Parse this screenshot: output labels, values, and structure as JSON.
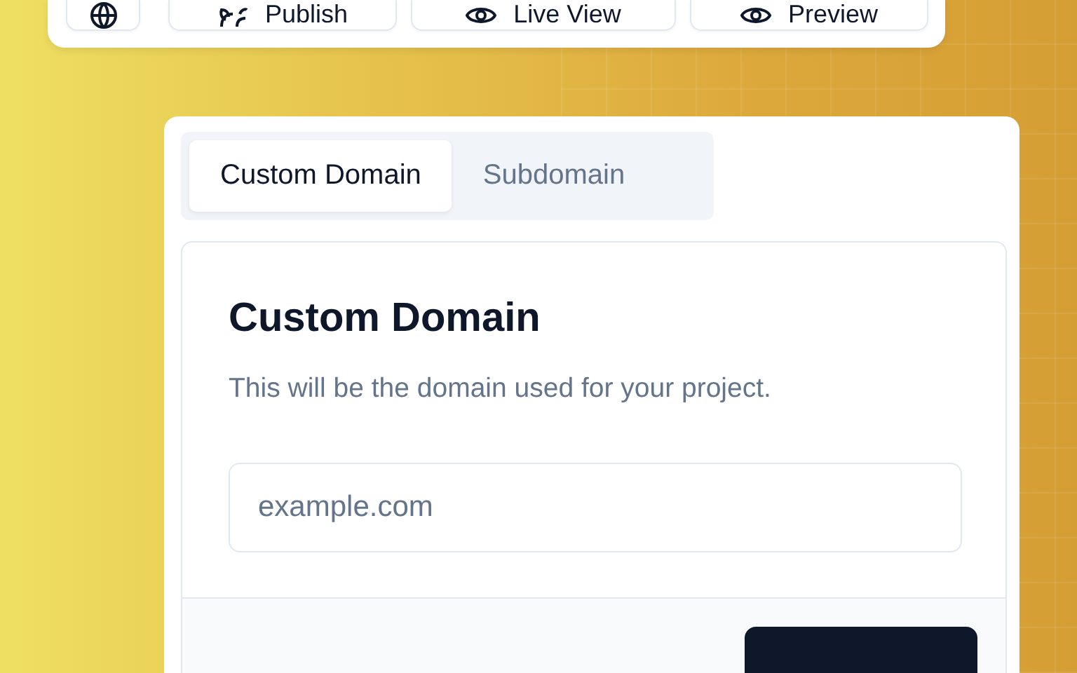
{
  "toolbar": {
    "buttons": [
      {
        "kind": "globe"
      },
      {
        "kind": "publish",
        "label": "Publish"
      },
      {
        "kind": "eye",
        "label": "Live View"
      },
      {
        "kind": "eye",
        "label": "Preview"
      }
    ]
  },
  "tabs": [
    {
      "label": "Custom Domain",
      "selected": true
    },
    {
      "label": "Subdomain",
      "selected": false
    }
  ],
  "panel": {
    "title": "Custom Domain",
    "description": "This will be the domain used for your project.",
    "field": {
      "placeholder": "example.com"
    }
  }
}
